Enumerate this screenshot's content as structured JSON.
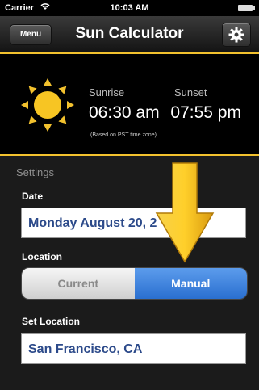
{
  "status_bar": {
    "carrier": "Carrier",
    "time": "10:03 AM"
  },
  "nav_bar": {
    "menu_label": "Menu",
    "title": "Sun Calculator",
    "settings_icon": "gear-icon"
  },
  "sun_info": {
    "icon": "sun-icon",
    "sunrise_label": "Sunrise",
    "sunset_label": "Sunset",
    "sunrise_time": "06:30 am",
    "sunset_time": "07:55 pm",
    "note": "(Based on PST time zone)"
  },
  "settings": {
    "section_title": "Settings",
    "date_label": "Date",
    "date_value": "Monday August 20, 2",
    "location_label": "Location",
    "location_options": [
      "Current",
      "Manual"
    ],
    "location_selected": "Manual",
    "set_location_label": "Set Location",
    "set_location_value": "San Francisco, CA"
  },
  "colors": {
    "accent_yellow": "#f2c12e",
    "segment_selected": "#3a82e0",
    "field_text": "#2c4a8a"
  }
}
